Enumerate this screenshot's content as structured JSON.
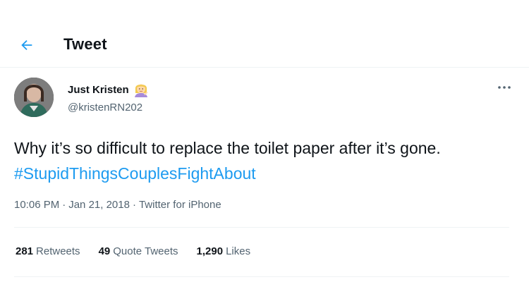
{
  "header": {
    "title": "Tweet",
    "back_icon": "arrow-left-icon",
    "accent_color": "#1d9bf0"
  },
  "author": {
    "name": "Just Kristen",
    "badge_icon": "woman-tipping-hand-emoji",
    "handle": "@kristenRN202",
    "more_icon": "more-horizontal-icon"
  },
  "tweet": {
    "text_before": "Why it’s so difficult to replace the toilet paper after it’s gone. ",
    "hashtag": "#StupidThingsCouplesFightAbout",
    "hashtag_color": "#1d9bf0"
  },
  "meta": {
    "time": "10:06 PM",
    "separator": "·",
    "date": "Jan 21, 2018",
    "source": "Twitter for iPhone"
  },
  "stats": {
    "retweets_count": "281",
    "retweets_label": "Retweets",
    "quotes_count": "49",
    "quotes_label": "Quote Tweets",
    "likes_count": "1,290",
    "likes_label": "Likes"
  },
  "colors": {
    "text_primary": "#0f1419",
    "text_secondary": "#536471",
    "divider": "#eff3f4"
  }
}
